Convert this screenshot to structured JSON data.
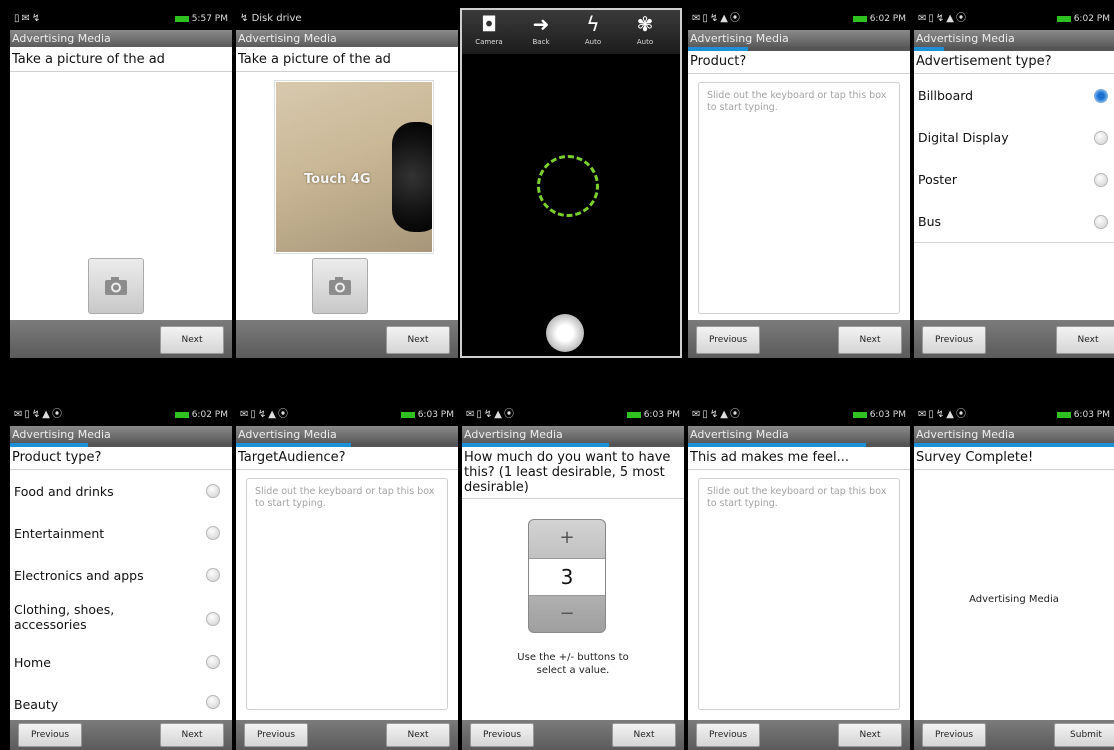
{
  "app_title": "Advertising Media",
  "screens": [
    {
      "time": "5:57",
      "ampm": "PM",
      "question": "Take a picture of the ad",
      "next": "Next"
    },
    {
      "notification": "Disk drive",
      "question": "Take a picture of the ad",
      "next": "Next",
      "photo_text": "Touch 4G"
    },
    {
      "camera": {
        "items": [
          {
            "icon": "camera-icon",
            "label": "Camera"
          },
          {
            "icon": "back-icon",
            "label": "Back"
          },
          {
            "icon": "flash-icon",
            "label": "Auto"
          },
          {
            "icon": "white-balance-icon",
            "label": "Auto"
          }
        ]
      }
    },
    {
      "time": "6:02",
      "ampm": "PM",
      "question": "Product?",
      "placeholder": "Slide out the keyboard or tap this box to start typing.",
      "prev": "Previous",
      "next": "Next"
    },
    {
      "time": "6:02",
      "ampm": "PM",
      "question": "Advertisement type?",
      "options": [
        "Billboard",
        "Digital Display",
        "Poster",
        "Bus"
      ],
      "selected": "Billboard",
      "prev": "Previous",
      "next": "Next"
    },
    {
      "time": "6:02",
      "ampm": "PM",
      "question": "Product type?",
      "options": [
        "Food and drinks",
        "Entertainment",
        "Electronics and apps",
        "Clothing, shoes, accessories",
        "Home",
        "Beauty"
      ],
      "prev": "Previous",
      "next": "Next"
    },
    {
      "time": "6:03",
      "ampm": "PM",
      "question": "TargetAudience?",
      "placeholder": "Slide out the keyboard or tap this box to start typing.",
      "prev": "Previous",
      "next": "Next"
    },
    {
      "time": "6:03",
      "ampm": "PM",
      "question": "How much do you want to have this? (1 least desirable, 5 most desirable)",
      "stepper": {
        "plus": "+",
        "value": "3",
        "minus": "−"
      },
      "hint": "Use the +/- buttons to select a value.",
      "prev": "Previous",
      "next": "Next"
    },
    {
      "time": "6:03",
      "ampm": "PM",
      "question": "This ad makes me feel...",
      "placeholder": "Slide out the keyboard or tap this box to start typing.",
      "prev": "Previous",
      "next": "Next"
    },
    {
      "time": "6:03",
      "ampm": "PM",
      "question": "Survey Complete!",
      "center_text": "Advertising Media",
      "prev": "Previous",
      "submit": "Submit"
    }
  ],
  "colors": {
    "progress": "#1e90d6",
    "focus_ring": "#7ad02c",
    "battery": "#2ec11f"
  }
}
